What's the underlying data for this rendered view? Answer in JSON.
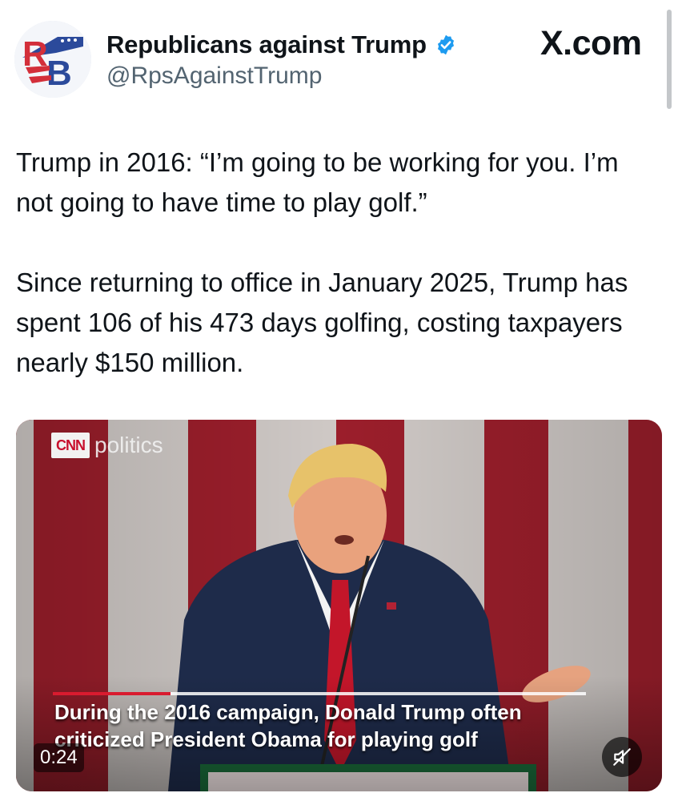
{
  "tweet": {
    "display_name": "Republicans against Trump",
    "handle": "@RpsAgainstTrump",
    "verified": true,
    "avatar_initials": "RB",
    "paragraphs": [
      "Trump in 2016: “I’m going to be working for you. I’m not going to have time to play golf.”",
      "Since returning to office in January 2025, Trump has spent 106 of his 473 days golfing, costing taxpayers nearly $150 million."
    ]
  },
  "watermark": "X.com",
  "video": {
    "network_logo": "CNN",
    "network_section": "politics",
    "caption_lines": [
      "During the 2016 campaign, Donald Trump often",
      "criticized President Obama for playing golf"
    ],
    "timestamp": "0:24",
    "progress_fraction": 0.22,
    "muted": true
  },
  "colors": {
    "verified_blue": "#1d9bf0",
    "avatar_red": "#d32f3a",
    "avatar_blue": "#2b4a9b",
    "cnn_red": "#c8102e"
  },
  "icons": [
    "verified-badge-icon",
    "muted-speaker-icon"
  ]
}
